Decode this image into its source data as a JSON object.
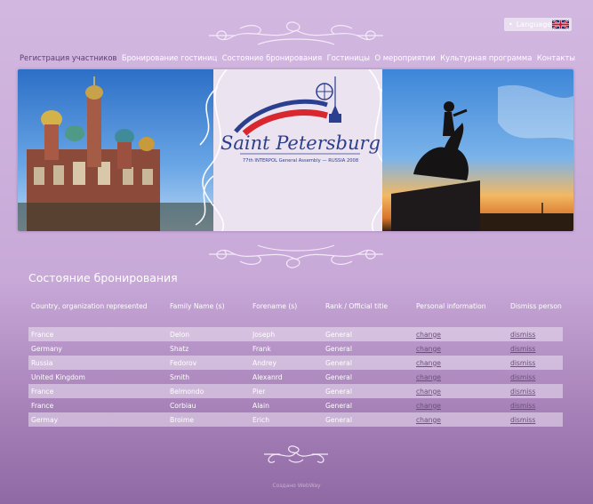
{
  "header": {
    "language_label": "Language",
    "language_bullet": "•"
  },
  "nav": {
    "items": [
      {
        "label": "Регистрация участников",
        "active": true
      },
      {
        "label": "Бронирование гостиниц"
      },
      {
        "label": "Состояние бронирования"
      },
      {
        "label": "Гостиницы"
      },
      {
        "label": "О мероприятии"
      },
      {
        "label": "Культурная программа"
      },
      {
        "label": "Контакты"
      }
    ]
  },
  "banner": {
    "logo_line1": "Saint Petersburg",
    "logo_subtitle": "77th INTERPOL General Assembly  —  RUSSIA 2008"
  },
  "page": {
    "title": "Состояние бронирования"
  },
  "table": {
    "headers": [
      "Country, organization represented",
      "Family Name (s)",
      "Forename (s)",
      "Rank / Official title",
      "Personal information",
      "Dismiss person"
    ],
    "link_change": "change",
    "link_dismiss": "dismiss",
    "rows": [
      [
        "France",
        "Delon",
        "Joseph",
        "General"
      ],
      [
        "Germany",
        "Shatz",
        "Frank",
        "General"
      ],
      [
        "Russia",
        "Fedorov",
        "Andrey",
        "General"
      ],
      [
        "United Kingdom",
        "Smith",
        "Alexanrd",
        "General"
      ],
      [
        "France",
        "Belmondo",
        "Pier",
        "General"
      ],
      [
        "France",
        "Corbiau",
        "Alain",
        "General"
      ],
      [
        "Germay",
        "Broime",
        "Erich",
        "General"
      ]
    ]
  },
  "footer": {
    "text": "Создано WebWay"
  },
  "colors": {
    "background": "#c8a9d8",
    "nav_active": "#5b3d74",
    "link": "#6a4f79",
    "logo_blue": "#2b3f8f",
    "logo_red": "#d8272f"
  }
}
